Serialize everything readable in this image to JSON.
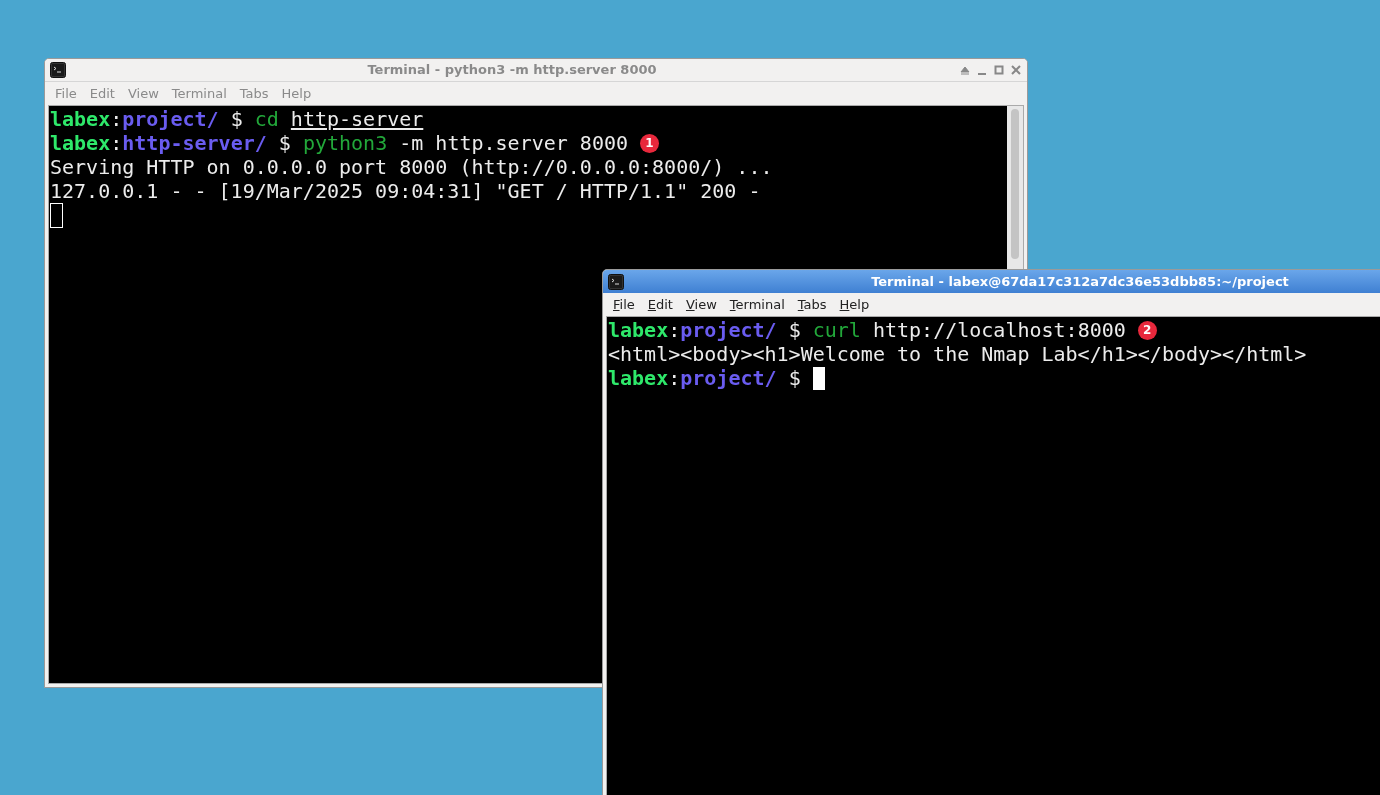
{
  "windows": [
    {
      "title": "Terminal - python3 -m http.server 8000",
      "active": false,
      "controls_visible": true,
      "scrollbar": true,
      "menu": [
        "File",
        "Edit",
        "View",
        "Terminal",
        "Tabs",
        "Help"
      ],
      "lines": [
        {
          "segments": [
            {
              "text": "labex",
              "kind": "user"
            },
            {
              "text": ":",
              "kind": "plain"
            },
            {
              "text": "project/",
              "kind": "path"
            },
            {
              "text": " $ ",
              "kind": "plain"
            },
            {
              "text": "cd ",
              "kind": "command"
            },
            {
              "text": "http-server",
              "kind": "underlined"
            }
          ]
        },
        {
          "segments": [
            {
              "text": "labex",
              "kind": "user"
            },
            {
              "text": ":",
              "kind": "plain"
            },
            {
              "text": "http-server/",
              "kind": "path"
            },
            {
              "text": " $ ",
              "kind": "plain"
            },
            {
              "text": "python3",
              "kind": "command"
            },
            {
              "text": " -m http.server 8000",
              "kind": "plain"
            }
          ],
          "badge": "1"
        },
        {
          "segments": [
            {
              "text": "Serving HTTP on 0.0.0.0 port 8000 (http://0.0.0.0:8000/) ...",
              "kind": "plain"
            }
          ]
        },
        {
          "segments": [
            {
              "text": "127.0.0.1 - - [19/Mar/2025 09:04:31] \"GET / HTTP/1.1\" 200 -",
              "kind": "plain"
            }
          ],
          "cursor": false
        },
        {
          "cursor": true
        }
      ]
    },
    {
      "title": "Terminal - labex@67da17c312a7dc36e53dbb85:~/project",
      "active": true,
      "controls_visible": false,
      "scrollbar": false,
      "menu": [
        "File",
        "Edit",
        "View",
        "Terminal",
        "Tabs",
        "Help"
      ],
      "lines": [
        {
          "segments": [
            {
              "text": "labex",
              "kind": "user"
            },
            {
              "text": ":",
              "kind": "plain"
            },
            {
              "text": "project/",
              "kind": "path"
            },
            {
              "text": " $ ",
              "kind": "plain"
            },
            {
              "text": "curl",
              "kind": "command"
            },
            {
              "text": " http://localhost:8000",
              "kind": "plain"
            }
          ],
          "badge": "2"
        },
        {
          "segments": [
            {
              "text": "<html><body><h1>Welcome to the Nmap Lab</h1></body></html>",
              "kind": "plain"
            }
          ]
        },
        {
          "segments": [
            {
              "text": "labex",
              "kind": "user"
            },
            {
              "text": ":",
              "kind": "plain"
            },
            {
              "text": "project/",
              "kind": "path"
            },
            {
              "text": " $ ",
              "kind": "plain"
            }
          ],
          "cursor": true
        }
      ]
    }
  ]
}
